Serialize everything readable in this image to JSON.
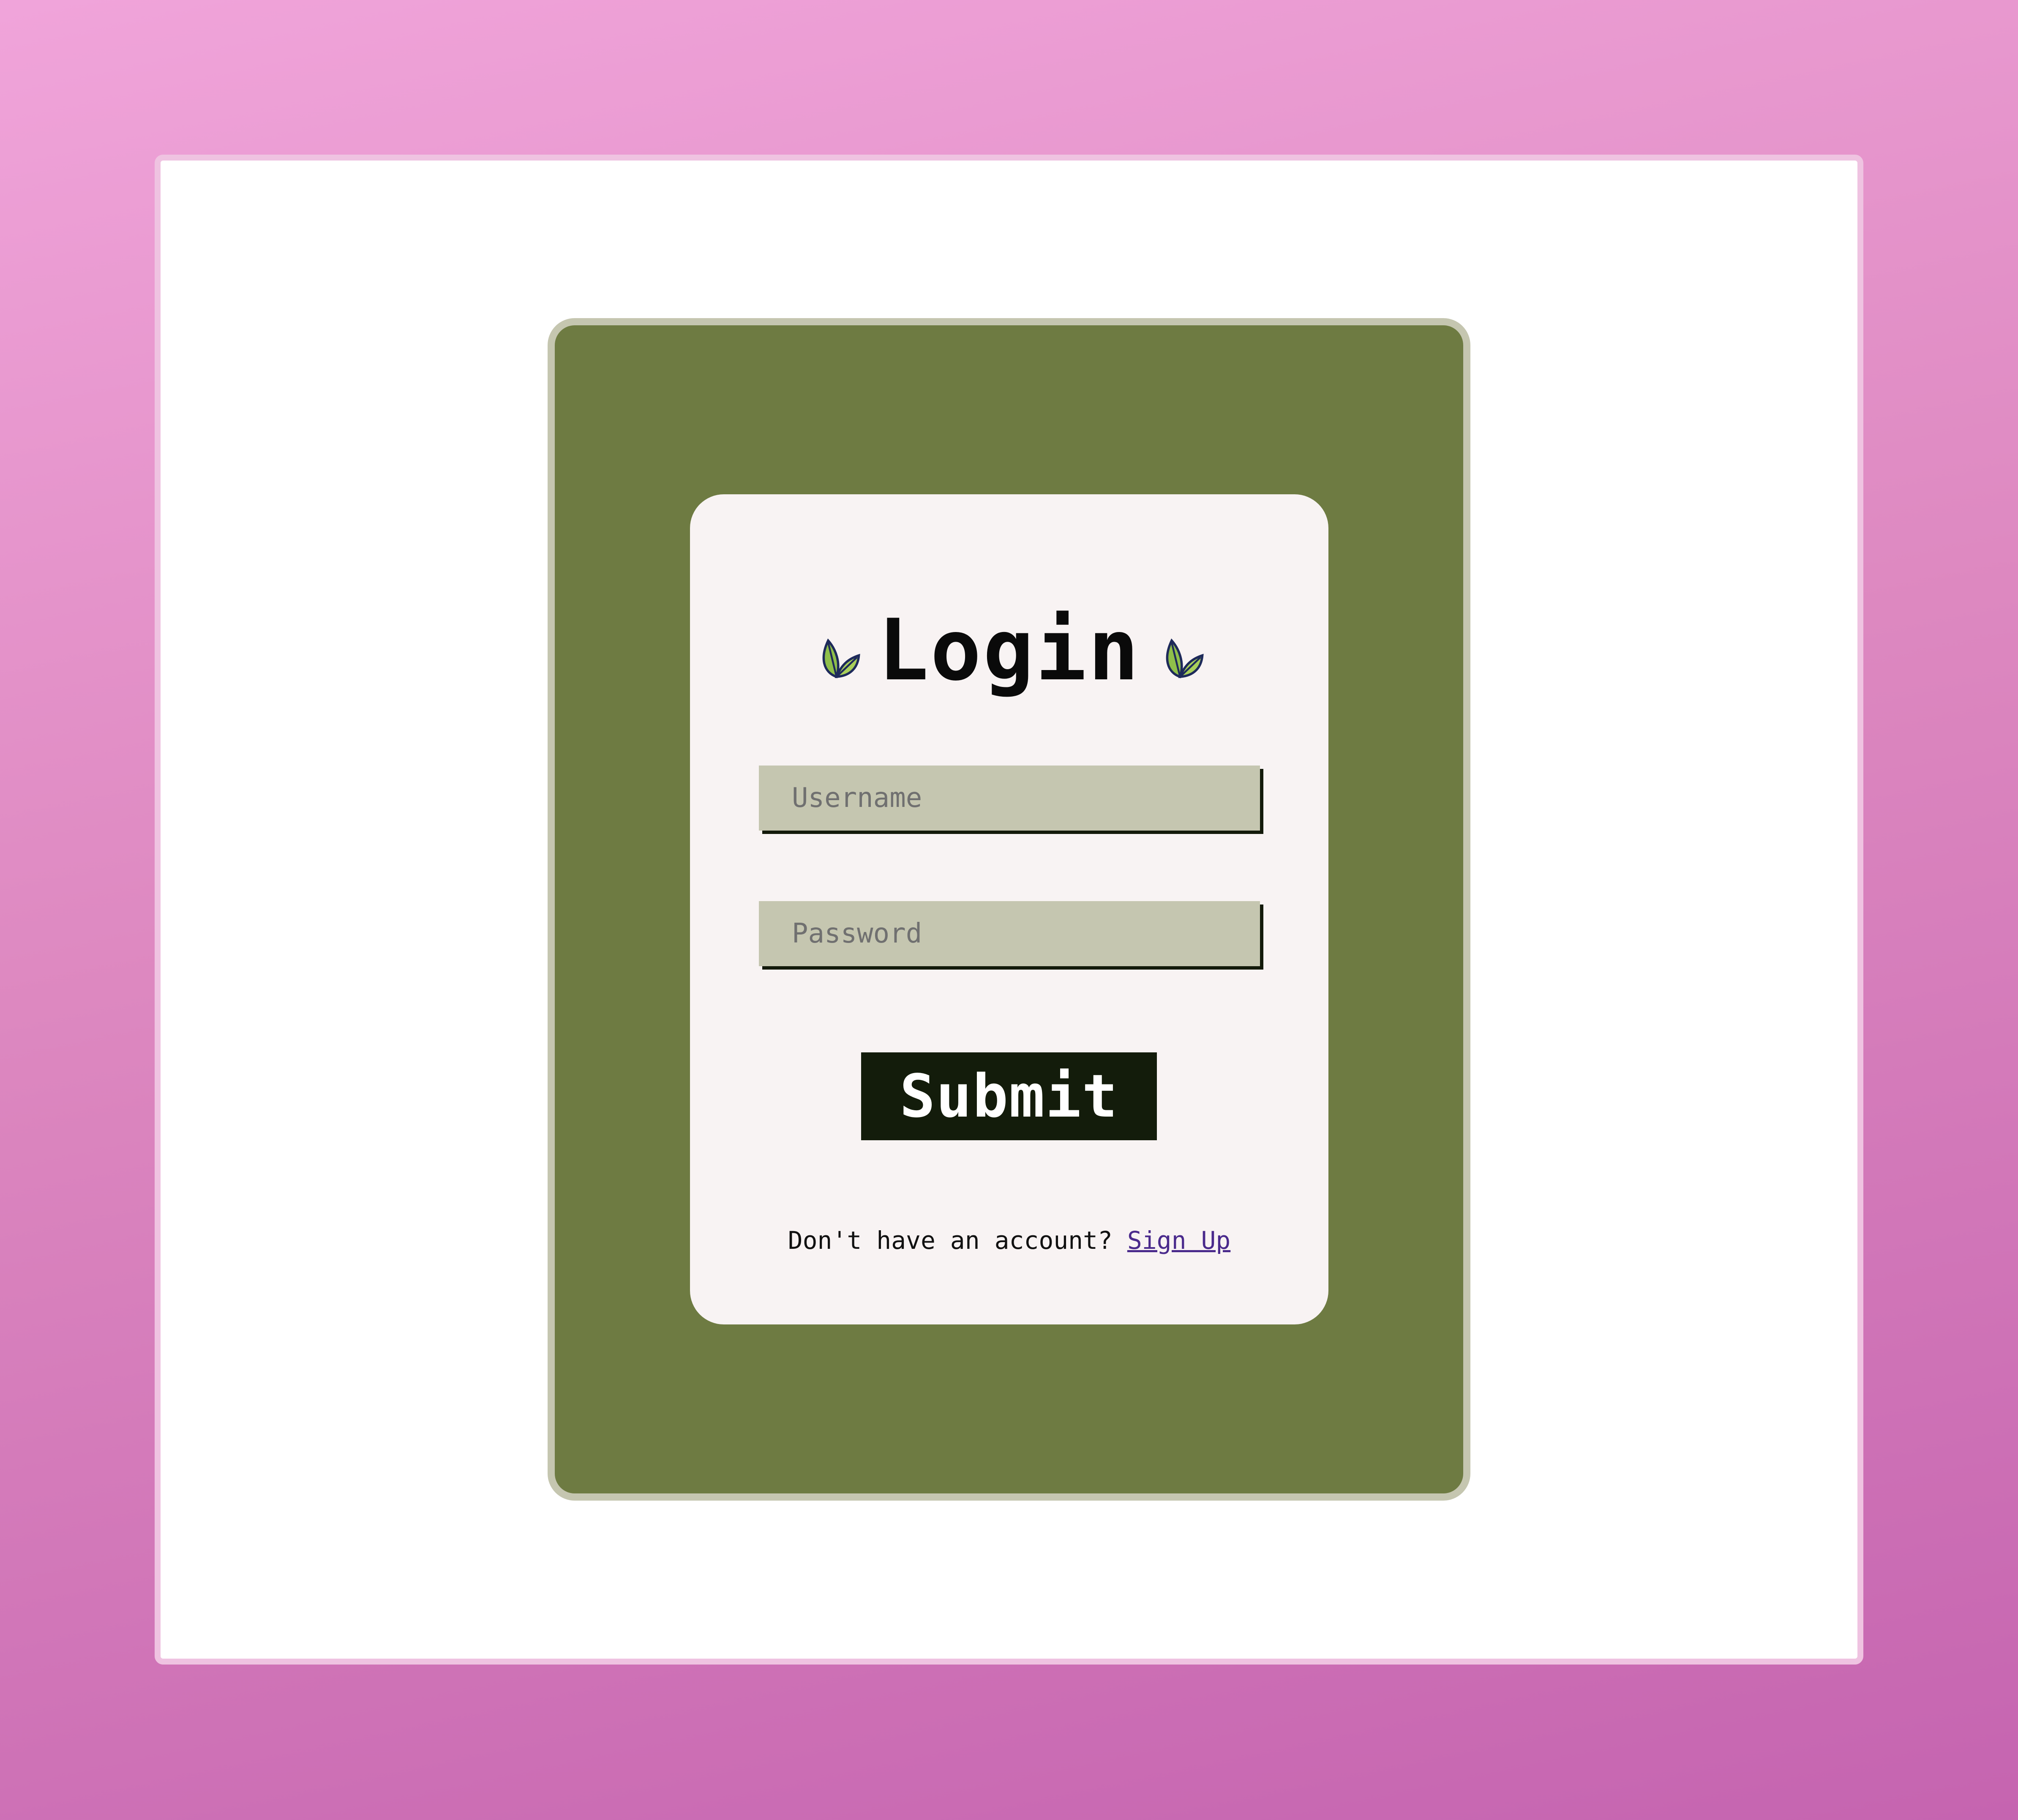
{
  "login": {
    "title": "Login",
    "leaf_icon": "leaf-icon",
    "username_placeholder": "Username",
    "password_placeholder": "Password",
    "submit_label": "Submit",
    "footer_text": "Don't have an account?",
    "signup_link": "Sign Up"
  },
  "colors": {
    "background_gradient_top": "#f0a4da",
    "background_gradient_bottom": "#c564b0",
    "outer_card": "#6e7b42",
    "inner_card": "#f8f3f3",
    "input_fill": "#c5c6b0",
    "button": "#131c0b",
    "link": "#4a2a8c",
    "leaf_green": "#8fbf4a"
  }
}
